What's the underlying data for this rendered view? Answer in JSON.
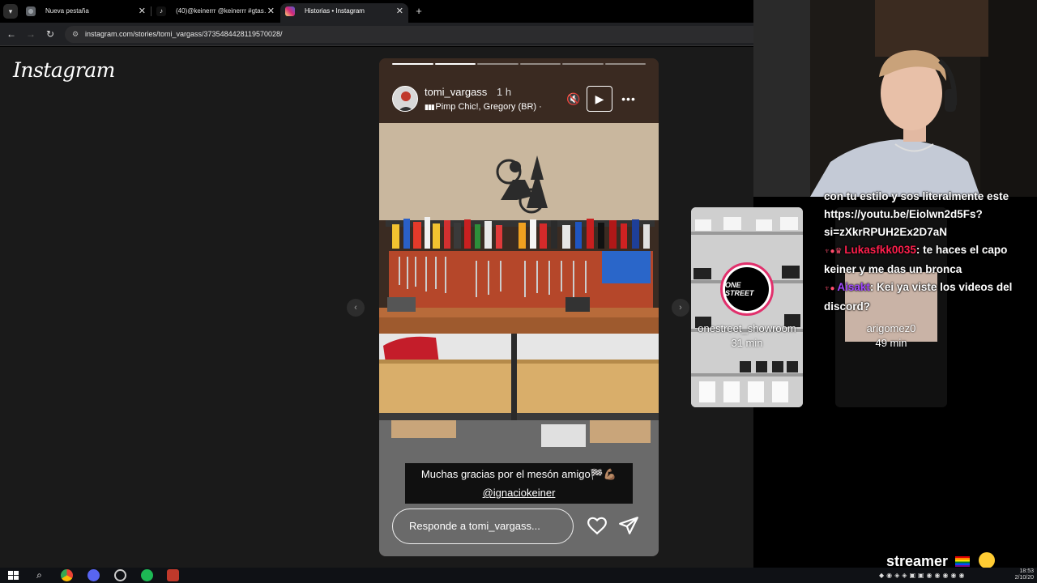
{
  "browser": {
    "tabs": [
      {
        "title": "Nueva pestaña",
        "active": false,
        "icon": "chrome-icon"
      },
      {
        "title": "(40)@keinerrr @keinerrr #gtas…",
        "active": false,
        "icon": "tiktok-icon"
      },
      {
        "title": "Historias • Instagram",
        "active": true,
        "icon": "instagram-icon"
      }
    ],
    "url": "instagram.com/stories/tomi_vargass/3735484428119570028/"
  },
  "instagram": {
    "logo": "Instagram",
    "story": {
      "username": "tomi_vargass",
      "time": "1 h",
      "song": "Pimp Chic!, Gregory (BR) ·",
      "progress_segments": 6,
      "progress_filled": 2,
      "caption_line1": "Muchas gracias por el mesón amigo🏁💪🏽",
      "caption_mention": "@ignaciokeiner",
      "reply_placeholder": "Responde a tomi_vargass..."
    },
    "next_previews": [
      {
        "username": "onestreet_showroom",
        "time": "31 min",
        "logo_text": "ONE STREET"
      },
      {
        "username": "arigomez0",
        "time": "49 min"
      }
    ]
  },
  "chat": {
    "messages": [
      {
        "user": "",
        "text": "con tu estilo y sos literalmente este https://youtu.be/Eiolwn2d5Fs?si=zXkrRPUH2Ex2D7aN"
      },
      {
        "user": "Lukasfkk0035",
        "text": ": te haces el capo keiner y me das un bronca",
        "color": "red"
      },
      {
        "user": "Aisakt",
        "text": ": Kei ya viste los videos del discord?",
        "color": "purple"
      }
    ]
  },
  "streamer_tag": "streamer",
  "taskbar": {
    "time": "18:53",
    "date": "2/10/20"
  },
  "colors": {
    "page_bg": "#1a1a1a",
    "chrome_bg": "#202124",
    "chat_red": "#ff1f4c",
    "chat_purple": "#a148ff"
  }
}
